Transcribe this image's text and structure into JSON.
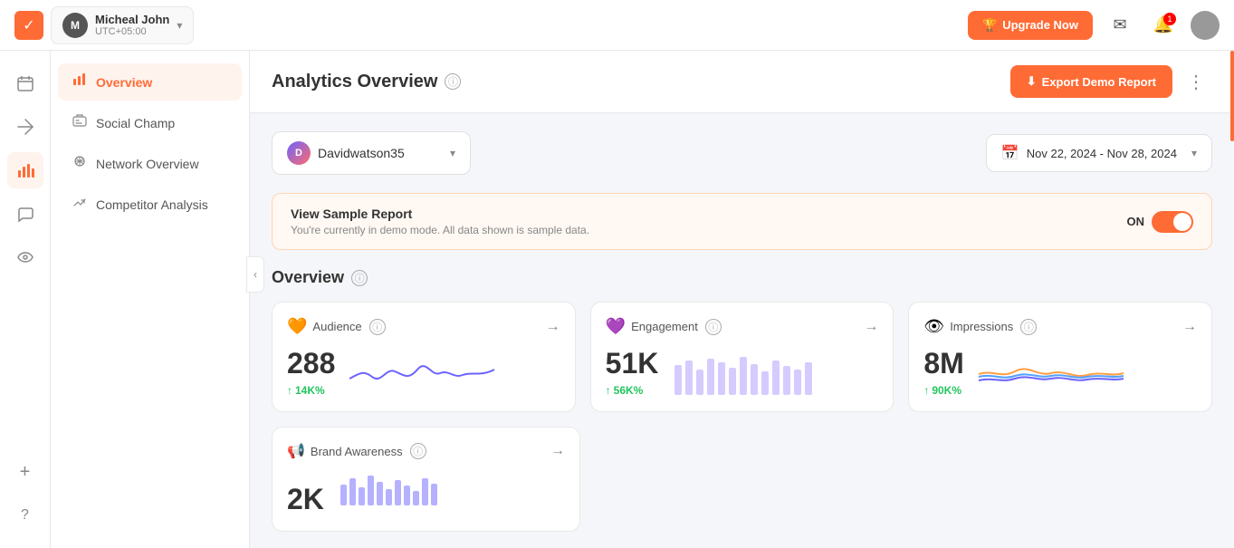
{
  "topbar": {
    "user": {
      "initials": "M",
      "name": "Micheal John",
      "timezone": "UTC+05:00"
    },
    "upgrade_label": "Upgrade Now",
    "notifications_count": "1"
  },
  "sidebar_icons": [
    {
      "id": "calendar",
      "symbol": "📅"
    },
    {
      "id": "paper-plane",
      "symbol": "✉"
    },
    {
      "id": "chart-bar",
      "symbol": "📊",
      "active": true
    },
    {
      "id": "chat",
      "symbol": "💬"
    },
    {
      "id": "waveform",
      "symbol": "📈"
    }
  ],
  "sidebar_nav": {
    "items": [
      {
        "id": "overview",
        "label": "Overview",
        "active": true
      },
      {
        "id": "social-champ",
        "label": "Social Champ"
      },
      {
        "id": "network-overview",
        "label": "Network Overview"
      },
      {
        "id": "competitor-analysis",
        "label": "Competitor Analysis"
      }
    ]
  },
  "header": {
    "title": "Analytics Overview",
    "export_label": "Export Demo Report",
    "more_icon": "⋮"
  },
  "filters": {
    "account": {
      "initials": "D",
      "name": "Davidwatson35"
    },
    "date_range": "Nov 22, 2024 - Nov 28, 2024"
  },
  "banner": {
    "title": "View Sample Report",
    "description": "You're currently in demo mode. All data shown is sample data.",
    "toggle_label": "ON"
  },
  "overview": {
    "title": "Overview",
    "cards": [
      {
        "id": "audience",
        "icon": "🟠",
        "title": "Audience",
        "value": "288",
        "change": "14K%",
        "chart_type": "line"
      },
      {
        "id": "engagement",
        "icon": "🟣",
        "title": "Engagement",
        "value": "51K",
        "change": "56K%",
        "chart_type": "bar"
      },
      {
        "id": "impressions",
        "icon": "🟡",
        "title": "Impressions",
        "value": "8M",
        "change": "90K%",
        "chart_type": "multiline"
      }
    ],
    "bottom_cards": [
      {
        "id": "brand-awareness",
        "icon": "📢",
        "title": "Brand Awareness",
        "value": "2K",
        "chart_type": "bar"
      }
    ]
  },
  "bottom_nav": [
    {
      "id": "add",
      "symbol": "+"
    },
    {
      "id": "help",
      "symbol": "?"
    }
  ]
}
